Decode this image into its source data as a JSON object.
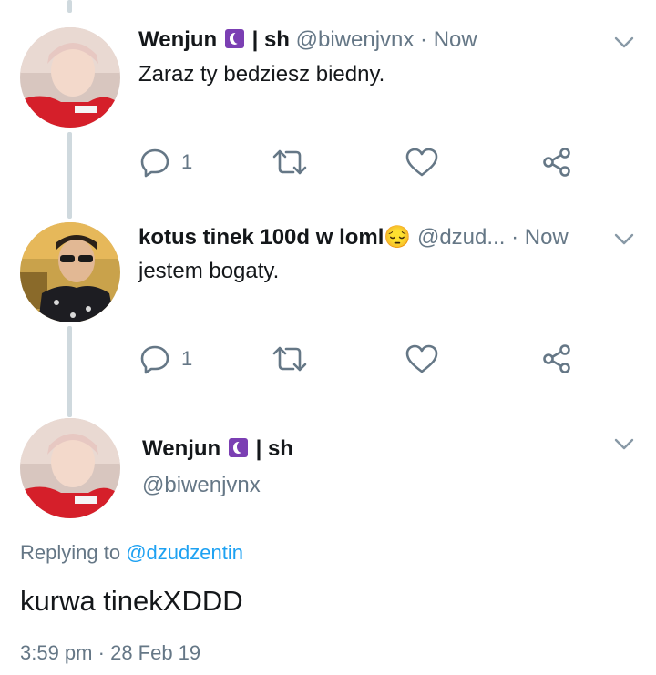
{
  "tweets": [
    {
      "name": "Wenjun",
      "name_suffix": "| sh",
      "handle": "@biwenjvnx",
      "separator": "·",
      "time": "Now",
      "text": "Zaraz ty bedziesz biedny.",
      "reply_count": "1"
    },
    {
      "name": "kotus tinek 100d w loml",
      "emoji": "😔",
      "handle": "@dzud...",
      "separator": "·",
      "time": "Now",
      "text": "jestem bogaty.",
      "reply_count": "1"
    }
  ],
  "focused": {
    "name": "Wenjun",
    "name_suffix": "| sh",
    "handle": "@biwenjvnx",
    "replying_prefix": "Replying to",
    "replying_mention": "@dzudzentin",
    "text": "kurwa tinekXDDD",
    "time": "3:59 pm",
    "separator": "·",
    "date": "28 Feb 19"
  },
  "colors": {
    "text": "#14171a",
    "secondary": "#657786",
    "link": "#1da1f2",
    "thread_line": "#cfd9de",
    "moon_badge": "#7b3fb3"
  },
  "icons": [
    "reply-icon",
    "retweet-icon",
    "like-icon",
    "share-icon",
    "chevron-down-icon",
    "moon-icon"
  ]
}
